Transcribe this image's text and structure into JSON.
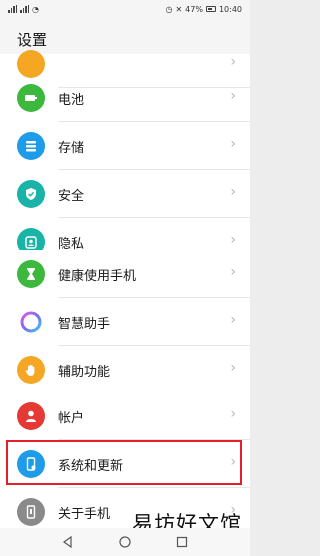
{
  "status_bar": {
    "battery": "47%",
    "time": "10:40"
  },
  "header": {
    "title": "设置"
  },
  "groups": [
    {
      "items": [
        {
          "label": "",
          "icon": "partial-icon",
          "color": "#f5a623"
        },
        {
          "label": "电池",
          "icon": "battery-icon",
          "color": "#3cb83c"
        },
        {
          "label": "存储",
          "icon": "storage-icon",
          "color": "#1e9be9"
        },
        {
          "label": "安全",
          "icon": "shield-icon",
          "color": "#19b4a7"
        },
        {
          "label": "隐私",
          "icon": "privacy-icon",
          "color": "#19b4a7"
        }
      ]
    },
    {
      "items": [
        {
          "label": "健康使用手机",
          "icon": "hourglass-icon",
          "color": "#3cb83c"
        },
        {
          "label": "智慧助手",
          "icon": "assistant-icon",
          "color": "#8f6ae6"
        },
        {
          "label": "辅助功能",
          "icon": "hand-icon",
          "color": "#f5a623"
        }
      ]
    },
    {
      "items": [
        {
          "label": "帐户",
          "icon": "account-icon",
          "color": "#e53935"
        },
        {
          "label": "系统和更新",
          "icon": "phone-system-icon",
          "color": "#1e9be9"
        },
        {
          "label": "关于手机",
          "icon": "phone-icon",
          "color": "#8a8a8a"
        }
      ]
    }
  ],
  "watermark": "易坊好文馆"
}
